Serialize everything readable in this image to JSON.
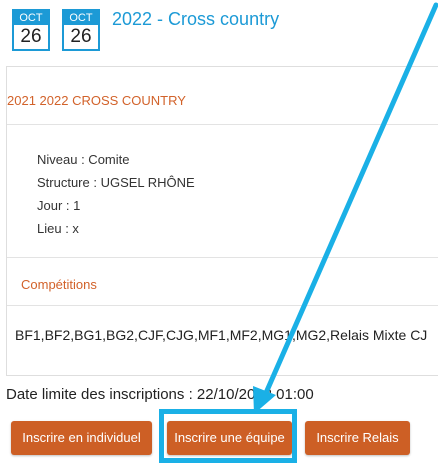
{
  "header": {
    "badges": [
      {
        "month": "OCT",
        "day": "26"
      },
      {
        "month": "OCT",
        "day": "26"
      }
    ],
    "title": "2022 - Cross country"
  },
  "card": {
    "title": "2021 2022 CROSS COUNTRY",
    "info": {
      "niveau": "Niveau : Comite",
      "structure": "Structure : UGSEL RHÔNE",
      "jour": "Jour : 1",
      "lieu": "Lieu : x"
    },
    "competitions_label": "Compétitions",
    "categories": "BF1,BF2,BG1,BG2,CJF,CJG,MF1,MF2,MG1,MG2,Relais Mixte CJ"
  },
  "deadline": "Date limite des inscriptions : 22/10/2022 01:00",
  "buttons": {
    "individual": "Inscrire en individuel",
    "team": "Inscrire une équipe",
    "relay": "Inscrire Relais"
  },
  "colors": {
    "accent_blue": "#1c9ad6",
    "brand_orange": "#cd5f25",
    "annotation": "#1ab0e6"
  }
}
